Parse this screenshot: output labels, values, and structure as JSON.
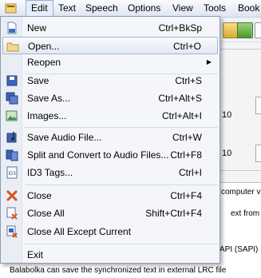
{
  "menubar": {
    "items": [
      "Edit",
      "Text",
      "Speech",
      "Options",
      "View",
      "Tools",
      "Book"
    ]
  },
  "background": {
    "values": [
      "10",
      "10"
    ],
    "text_lines": [
      "computer v",
      "ext from DO",
      "API (SAPI)",
      "Balabolka can save the synchronized text in external LRC file"
    ]
  },
  "file_menu": {
    "items": [
      {
        "label": "New",
        "shortcut": "Ctrl+BkSp",
        "icon": "new-document-icon"
      },
      {
        "label": "Open...",
        "shortcut": "Ctrl+O",
        "icon": "open-folder-icon"
      },
      {
        "label": "Reopen",
        "shortcut": "",
        "icon": ""
      },
      {
        "label": "Save",
        "shortcut": "Ctrl+S",
        "icon": "save-icon"
      },
      {
        "label": "Save As...",
        "shortcut": "Ctrl+Alt+S",
        "icon": "save-as-icon"
      },
      {
        "label": "Images...",
        "shortcut": "Ctrl+Alt+I",
        "icon": "images-icon"
      },
      {
        "label": "Save Audio File...",
        "shortcut": "Ctrl+W",
        "icon": "save-audio-icon"
      },
      {
        "label": "Split and Convert to Audio Files...",
        "shortcut": "Ctrl+F8",
        "icon": "split-convert-icon"
      },
      {
        "label": "ID3 Tags...",
        "shortcut": "Ctrl+I",
        "icon": "id3-tags-icon"
      },
      {
        "label": "Close",
        "shortcut": "Ctrl+F4",
        "icon": "close-icon"
      },
      {
        "label": "Close All",
        "shortcut": "Shift+Ctrl+F4",
        "icon": "close-all-icon"
      },
      {
        "label": "Close All Except Current",
        "shortcut": "",
        "icon": "close-all-except-icon"
      },
      {
        "label": "Exit",
        "shortcut": "",
        "icon": ""
      }
    ]
  }
}
